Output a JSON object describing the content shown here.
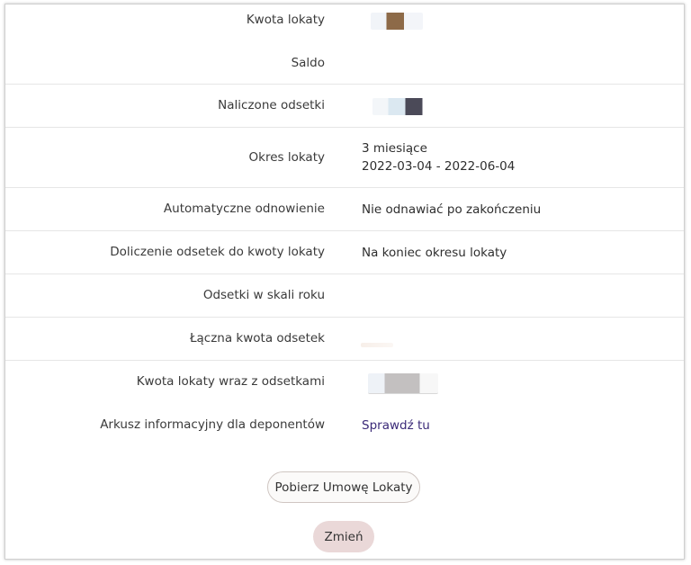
{
  "details": {
    "kwota_lokaty": {
      "label": "Kwota lokaty"
    },
    "saldo": {
      "label": "Saldo"
    },
    "naliczone_odsetki": {
      "label": "Naliczone odsetki"
    },
    "okres_lokaty": {
      "label": "Okres lokaty",
      "value_line1": "3 miesiące",
      "value_line2": "2022-03-04 - 2022-06-04"
    },
    "automatyczne_odnowienie": {
      "label": "Automatyczne odnowienie",
      "value": "Nie odnawiać po zakończeniu"
    },
    "doliczenie_odsetek": {
      "label": "Doliczenie odsetek do kwoty lokaty",
      "value": "Na koniec okresu lokaty"
    },
    "odsetki_w_skali_roku": {
      "label": "Odsetki w skali roku"
    },
    "laczna_kwota_odsetek": {
      "label": "Łączna kwota odsetek"
    },
    "kwota_z_odsetkami": {
      "label": "Kwota lokaty wraz z odsetkami"
    },
    "arkusz": {
      "label": "Arkusz informacyjny dla deponentów",
      "link": "Sprawdź tu"
    }
  },
  "buttons": {
    "download_label": "Pobierz Umowę Lokaty",
    "change_label": "Zmień"
  }
}
